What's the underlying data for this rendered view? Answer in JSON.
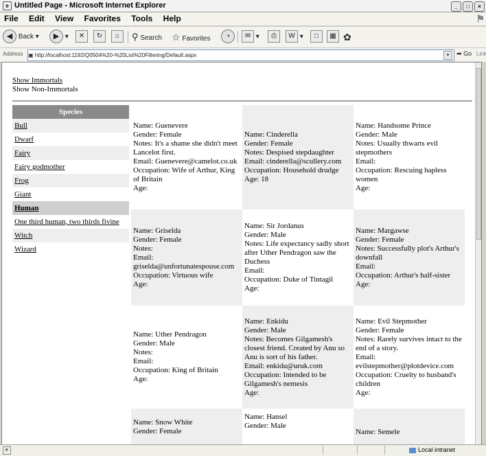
{
  "window": {
    "title": "Untitled Page - Microsoft Internet Explorer"
  },
  "menu": [
    "File",
    "Edit",
    "View",
    "Favorites",
    "Tools",
    "Help"
  ],
  "toolbar": {
    "back": "Back",
    "search": "Search",
    "favorites": "Favorites"
  },
  "address": {
    "label": "Address",
    "url": "http://localhost:1192/Q0504%20-%20List%20Filtering/Default.aspx",
    "go": "Go",
    "links": "Links"
  },
  "page": {
    "show_immortals": "Show Immortals",
    "show_non_immortals": "Show Non-Immortals",
    "species_header": "Species",
    "species": [
      "Bull",
      "Dwarf",
      "Fairy",
      "Fairy godmother",
      "Frog",
      "Giant",
      "Human",
      "One third human, two thirds fivine",
      "Witch",
      "Wizard"
    ],
    "selected_species": "Human",
    "people": [
      {
        "name": "Name: Guenevere",
        "gender": "Gender: Female",
        "notes": "Notes: It's a shame she didn't meet Lancelot first.",
        "email": "Email: Guenevere@camelot.co.uk",
        "occupation": "Occupation: Wife of Arthur, King of Britain",
        "age": "Age:"
      },
      {
        "name": "Name: Cinderella",
        "gender": "Gender: Female",
        "notes": "Notes: Despised stepdaughter",
        "email": "Email: cinderella@scullery.com",
        "occupation": "Occupation: Household drudge",
        "age": "Age: 18"
      },
      {
        "name": "Name: Handsome Prince",
        "gender": "Gender: Male",
        "notes": "Notes: Usually thwarts evil stepmothers",
        "email": "Email:",
        "occupation": "Occupation: Rescuing hapless women",
        "age": "Age:"
      },
      {
        "name": "Name: Griselda",
        "gender": "Gender: Female",
        "notes": "Notes:",
        "email": "Email: griselda@unfortunatespouse.com",
        "occupation": "Occupation: Virtuous wife",
        "age": "Age:"
      },
      {
        "name": "Name: Sir Jordanus",
        "gender": "Gender: Male",
        "notes": "Notes: Life expectancy sadly short after Uther Pendragon saw the Duchess",
        "email": "Email:",
        "occupation": "Occupation: Duke of Tintagil",
        "age": "Age:"
      },
      {
        "name": "Name: Margawse",
        "gender": "Gender: Female",
        "notes": "Notes: Successfully plot's Arthur's downfall",
        "email": "Email:",
        "occupation": "Occupation: Arthur's half-sister",
        "age": "Age:"
      },
      {
        "name": "Name: Uther Pendragon",
        "gender": "Gender: Male",
        "notes": "Notes:",
        "email": "Email:",
        "occupation": "Occupation: King of Britain",
        "age": "Age:"
      },
      {
        "name": "Name: Enkidu",
        "gender": "Gender: Male",
        "notes": "Notes: Becomes Gilgamesh's closest friend. Created by Anu so Anu is sort of his father.",
        "email": "Email: enkidu@uruk.com",
        "occupation": "Occupation: Intended to be Gilgamesh's nemesis",
        "age": "Age:"
      },
      {
        "name": "Name: Evil Stepmother",
        "gender": "Gender: Female",
        "notes": "Notes: Rarely survives intact to the end of a story.",
        "email": "Email: evilstepmother@plotdevice.com",
        "occupation": "Occupation: Cruelty to husband's children",
        "age": "Age:"
      },
      {
        "name": "Name: Snow White",
        "gender": "Gender: Female",
        "notes": "",
        "email": "",
        "occupation": "",
        "age": ""
      },
      {
        "name": "Name: Hansel",
        "gender": "Gender: Male",
        "notes": "",
        "email": "",
        "occupation": "",
        "age": ""
      },
      {
        "name": "Name: Semele",
        "gender": "",
        "notes": "",
        "email": "",
        "occupation": "",
        "age": ""
      }
    ]
  },
  "status": {
    "zone": "Local intranet"
  }
}
